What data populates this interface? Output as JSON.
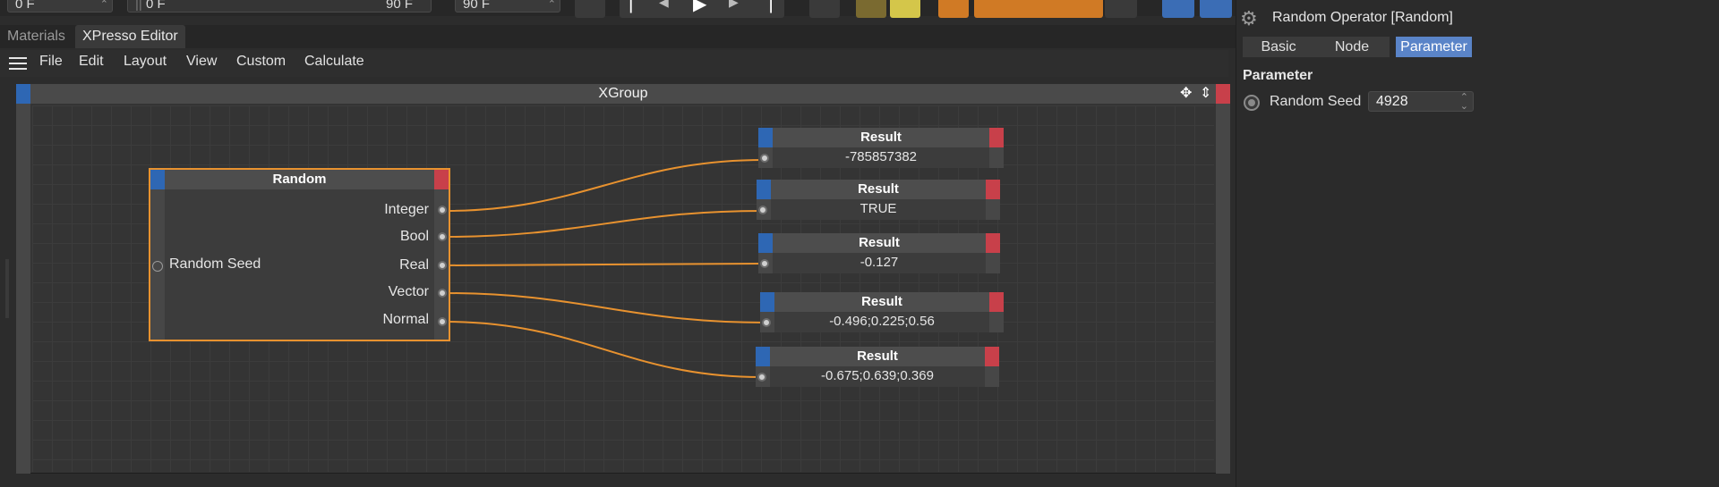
{
  "toolbar": {
    "frame_start": "0 F",
    "range_start": "0 F",
    "range_end": "90 F",
    "frame_end": "90 F"
  },
  "tabs": [
    {
      "label": "Materials",
      "active": false
    },
    {
      "label": "XPresso Editor",
      "active": true
    }
  ],
  "menu": {
    "items": [
      "File",
      "Edit",
      "Layout",
      "View",
      "Custom",
      "Calculate"
    ]
  },
  "xgroup": {
    "title": "XGroup"
  },
  "random_node": {
    "title": "Random",
    "input": "Random Seed",
    "outputs": [
      "Integer",
      "Bool",
      "Real",
      "Vector",
      "Normal"
    ]
  },
  "result_nodes": [
    {
      "title": "Result",
      "value": "-785857382"
    },
    {
      "title": "Result",
      "value": "TRUE"
    },
    {
      "title": "Result",
      "value": "-0.127"
    },
    {
      "title": "Result",
      "value": "-0.496;0.225;0.56"
    },
    {
      "title": "Result",
      "value": "-0.675;0.639;0.369"
    }
  ],
  "panel": {
    "title": "Random Operator [Random]",
    "tabs": [
      {
        "label": "Basic",
        "active": false
      },
      {
        "label": "Node",
        "active": false
      },
      {
        "label": "Parameter",
        "active": true
      }
    ],
    "section": "Parameter",
    "param_label": "Random Seed",
    "param_value": "4928"
  },
  "colors": {
    "wire": "#e8922f",
    "port_in": "#2e67b4",
    "port_out": "#c8404a",
    "accent": "#5a84c8"
  }
}
